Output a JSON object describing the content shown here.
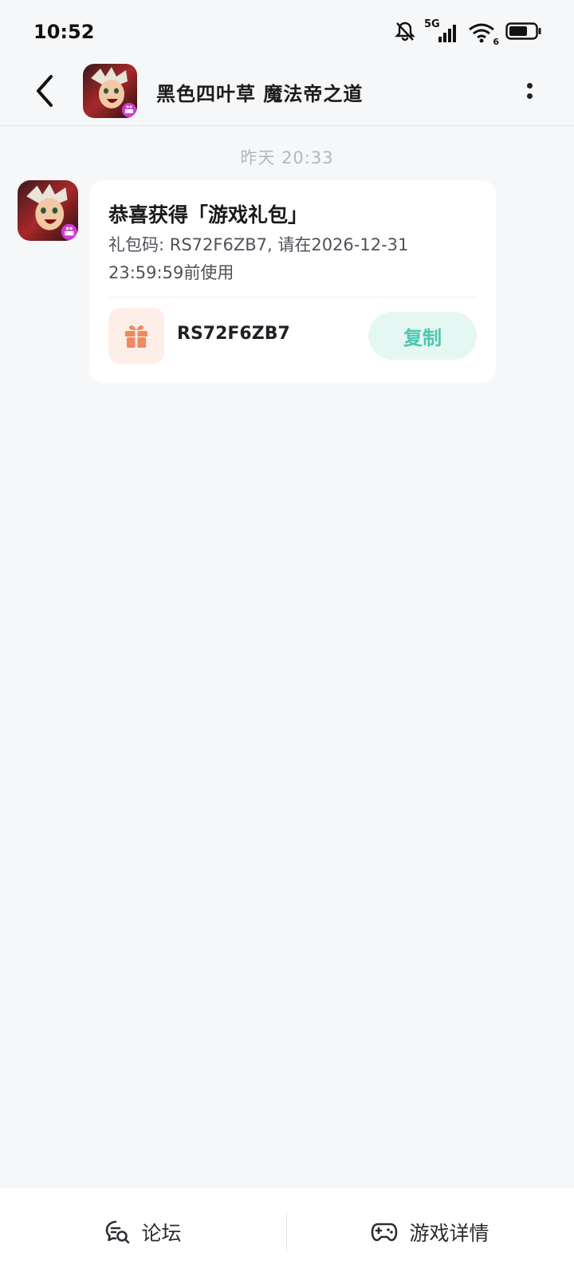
{
  "status_bar": {
    "time": "10:52",
    "network": "5G",
    "wifi_badge": "6",
    "icons": [
      "bell-muted-icon",
      "signal-icon",
      "wifi-icon",
      "battery-icon"
    ],
    "battery_level": 0.6
  },
  "header": {
    "title": "黑色四叶草 魔法帝之道",
    "icons": [
      "back-icon",
      "game-avatar",
      "more-icon"
    ]
  },
  "chat": {
    "timestamp": "昨天  20:33",
    "message": {
      "title": "恭喜获得「游戏礼包」",
      "body": "礼包码: RS72F6ZB7, 请在2026-12-31 23:59:59前使用",
      "code": "RS72F6ZB7",
      "copy_label": "复制",
      "gift_icon": "gift-icon"
    }
  },
  "bottom_bar": {
    "forum_label": "论坛",
    "forum_icon": "forum-icon",
    "detail_label": "游戏详情",
    "detail_icon": "gamepad-icon"
  },
  "colors": {
    "background": "#f6f7f9",
    "accent": "#4cc8ae",
    "copy_button_bg": "#e5f7f3",
    "gift_icon": "#ee8a5f",
    "gift_bg": "#fdeee8"
  }
}
